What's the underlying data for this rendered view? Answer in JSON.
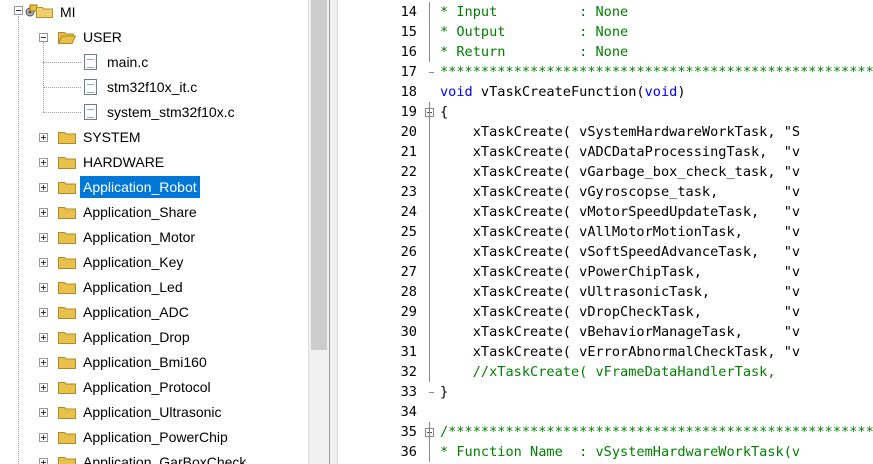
{
  "tree": {
    "root": "MI",
    "nodes": [
      {
        "label": "USER",
        "kind": "folder",
        "expanded": true
      },
      {
        "label": "main.c",
        "kind": "file"
      },
      {
        "label": "stm32f10x_it.c",
        "kind": "file"
      },
      {
        "label": "system_stm32f10x.c",
        "kind": "file"
      },
      {
        "label": "SYSTEM",
        "kind": "folder"
      },
      {
        "label": "HARDWARE",
        "kind": "folder"
      },
      {
        "label": "Application_Robot",
        "kind": "folder",
        "selected": true
      },
      {
        "label": "Application_Share",
        "kind": "folder"
      },
      {
        "label": "Application_Motor",
        "kind": "folder"
      },
      {
        "label": "Application_Key",
        "kind": "folder"
      },
      {
        "label": "Application_Led",
        "kind": "folder"
      },
      {
        "label": "Application_ADC",
        "kind": "folder"
      },
      {
        "label": "Application_Drop",
        "kind": "folder"
      },
      {
        "label": "Application_Bmi160",
        "kind": "folder"
      },
      {
        "label": "Application_Protocol",
        "kind": "folder"
      },
      {
        "label": "Application_Ultrasonic",
        "kind": "folder"
      },
      {
        "label": "Application_PowerChip",
        "kind": "folder"
      },
      {
        "label": "Application_GarBoxCheck",
        "kind": "folder"
      }
    ]
  },
  "editor": {
    "lines": [
      {
        "n": "14",
        "text": "* Input          : None"
      },
      {
        "n": "15",
        "text": "* Output         : None"
      },
      {
        "n": "16",
        "text": "* Return         : None"
      },
      {
        "n": "17",
        "text": "*****************************************************"
      },
      {
        "n": "18",
        "text": "void vTaskCreateFunction(void)"
      },
      {
        "n": "19",
        "text": "{"
      },
      {
        "n": "20",
        "text": "    xTaskCreate( vSystemHardwareWorkTask, \"S"
      },
      {
        "n": "21",
        "text": "    xTaskCreate( vADCDataProcessingTask,  \"v"
      },
      {
        "n": "22",
        "text": "    xTaskCreate( vGarbage_box_check_task, \"v"
      },
      {
        "n": "23",
        "text": "    xTaskCreate( vGyroscopse_task,        \"v"
      },
      {
        "n": "24",
        "text": "    xTaskCreate( vMotorSpeedUpdateTask,   \"v"
      },
      {
        "n": "25",
        "text": "    xTaskCreate( vAllMotorMotionTask,     \"v"
      },
      {
        "n": "26",
        "text": "    xTaskCreate( vSoftSpeedAdvanceTask,   \"v"
      },
      {
        "n": "27",
        "text": "    xTaskCreate( vPowerChipTask,          \"v"
      },
      {
        "n": "28",
        "text": "    xTaskCreate( vUltrasonicTask,         \"v"
      },
      {
        "n": "29",
        "text": "    xTaskCreate( vDropCheckTask,          \"v"
      },
      {
        "n": "30",
        "text": "    xTaskCreate( vBehaviorManageTask,     \"v"
      },
      {
        "n": "31",
        "text": "    xTaskCreate( vErrorAbnormalCheckTask, \"v"
      },
      {
        "n": "32",
        "text": "    //xTaskCreate( vFrameDataHandlerTask,"
      },
      {
        "n": "33",
        "text": "}"
      },
      {
        "n": "34",
        "text": ""
      },
      {
        "n": "35",
        "text": "/****************************************************"
      },
      {
        "n": "36",
        "text": "* Function Name  : vSystemHardwareWorkTask(v"
      }
    ]
  },
  "colors": {
    "selection": "#0078d7",
    "comment": "#008000",
    "keyword": "#0000ff",
    "folder": "#e8c04a"
  }
}
